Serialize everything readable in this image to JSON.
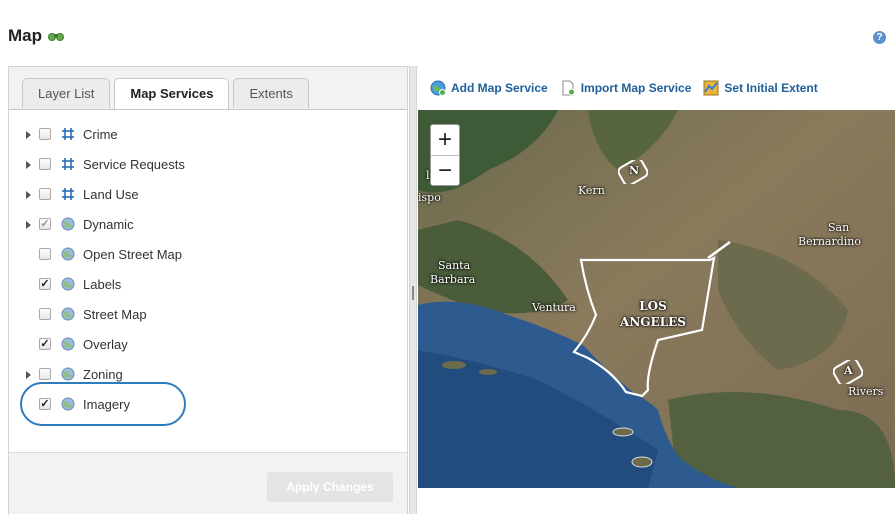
{
  "page": {
    "title": "Map",
    "help_glyph": "?"
  },
  "tabs": [
    {
      "label": "Layer List",
      "active": false
    },
    {
      "label": "Map Services",
      "active": true
    },
    {
      "label": "Extents",
      "active": false
    }
  ],
  "layers": [
    {
      "label": "Crime",
      "expandable": true,
      "checked": false,
      "icon": "feature-grid-icon"
    },
    {
      "label": "Service Requests",
      "expandable": true,
      "checked": false,
      "icon": "feature-grid-icon"
    },
    {
      "label": "Land Use",
      "expandable": true,
      "checked": false,
      "icon": "feature-grid-icon"
    },
    {
      "label": "Dynamic",
      "expandable": true,
      "checked": true,
      "dimmed": true,
      "icon": "globe-icon"
    },
    {
      "label": "Open Street Map",
      "expandable": false,
      "checked": false,
      "icon": "globe-icon"
    },
    {
      "label": "Labels",
      "expandable": false,
      "checked": true,
      "icon": "globe-icon"
    },
    {
      "label": "Street Map",
      "expandable": false,
      "checked": false,
      "icon": "globe-icon"
    },
    {
      "label": "Overlay",
      "expandable": false,
      "checked": true,
      "icon": "globe-icon"
    },
    {
      "label": "Zoning",
      "expandable": true,
      "checked": false,
      "icon": "globe-icon"
    },
    {
      "label": "Imagery",
      "expandable": false,
      "checked": true,
      "icon": "globe-icon",
      "highlighted": true
    }
  ],
  "buttons": {
    "apply": "Apply Changes"
  },
  "toolbar": {
    "add": "Add Map Service",
    "import": "Import Map Service",
    "extent": "Set Initial Extent"
  },
  "zoom": {
    "in": "+",
    "out": "−"
  },
  "map_labels": {
    "kern": "Kern",
    "santa_barbara_1": "Santa",
    "santa_barbara_2": "Barbara",
    "ventura": "Ventura",
    "la_1": "LOS",
    "la_2": "ANGELES",
    "san_bernardino_1": "San",
    "san_bernardino_2": "Bernardino",
    "riverside": "Rivers",
    "slo_fragment": "ispo",
    "left_fragment": "l",
    "shield_n": "N",
    "shield_a": "A"
  },
  "colors": {
    "accent": "#2e7bbd",
    "link": "#1f5f9a",
    "ocean": "#2d5a8f"
  }
}
